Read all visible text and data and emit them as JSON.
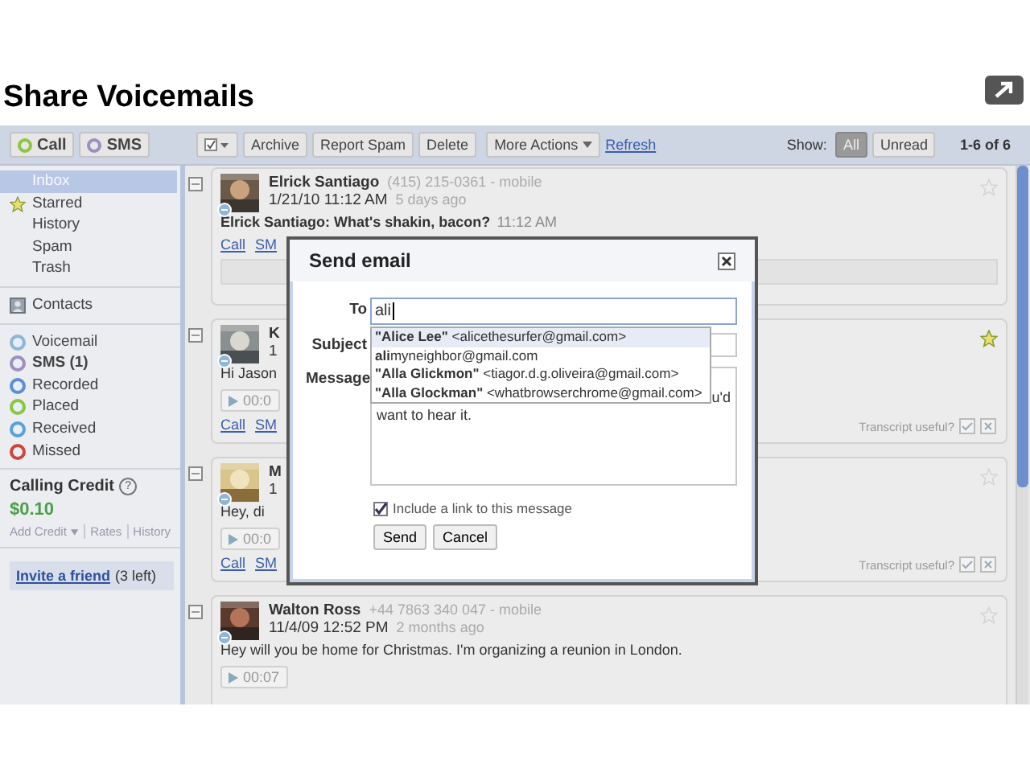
{
  "page": {
    "title": "Share Voicemails"
  },
  "toolbar": {
    "quick_buttons": [
      {
        "label": "Call",
        "color": "#8cc63e"
      },
      {
        "label": "SMS",
        "color": "#9c8fc0"
      }
    ],
    "actions": [
      "Archive",
      "Report Spam",
      "Delete"
    ],
    "more_actions": "More Actions",
    "refresh": "Refresh",
    "show_label": "Show:",
    "filters": [
      {
        "label": "All",
        "selected": true
      },
      {
        "label": "Unread",
        "selected": false
      }
    ],
    "pagination": "1-6 of 6"
  },
  "sidebar": {
    "folders": [
      {
        "label": "Inbox",
        "selected": true,
        "kind": "plain"
      },
      {
        "label": "Starred",
        "selected": false,
        "kind": "star"
      },
      {
        "label": "History",
        "selected": false,
        "kind": "plain"
      },
      {
        "label": "Spam",
        "selected": false,
        "kind": "plain"
      },
      {
        "label": "Trash",
        "selected": false,
        "kind": "plain"
      }
    ],
    "contacts": "Contacts",
    "categories": [
      {
        "label": "Voicemail",
        "color": "#8fb5d9",
        "unread": false
      },
      {
        "label": "SMS (1)",
        "color": "#9c8fc0",
        "unread": true
      },
      {
        "label": "Recorded",
        "color": "#5b8ed6",
        "unread": false
      },
      {
        "label": "Placed",
        "color": "#8cc63e",
        "unread": false
      },
      {
        "label": "Received",
        "color": "#5aa0d8",
        "unread": false
      },
      {
        "label": "Missed",
        "color": "#d0443a",
        "unread": false
      }
    ],
    "credit": {
      "title": "Calling Credit",
      "help": "?",
      "amount": "$0.10",
      "links": [
        "Add Credit",
        "Rates",
        "History"
      ]
    },
    "invite": {
      "link": "Invite a friend",
      "note": "(3 left)"
    }
  },
  "messages": [
    {
      "kind": "sms",
      "name": "Elrick Santiago",
      "phone": "(415) 215-0361 - mobile",
      "date": "1/21/10 11:12 AM",
      "ago": "5 days ago",
      "snippet": "Elrick Santiago: What's shakin, bacon?",
      "snippet_time": "11:12 AM",
      "actions": [
        "Call",
        "SM"
      ],
      "starred": false,
      "checked": false
    },
    {
      "kind": "voicemail",
      "name": "K",
      "date": "1",
      "snippet": "Hi Jason",
      "duration": "00:0",
      "actions": [
        "Call",
        "SM"
      ],
      "transcript_prompt": "Transcript useful?",
      "starred": true,
      "checked": false
    },
    {
      "kind": "voicemail",
      "name": "M",
      "date": "1",
      "snippet": "Hey, di",
      "duration": "00:0",
      "actions": [
        "Call",
        "SM"
      ],
      "transcript_prompt": "Transcript useful?",
      "starred": false,
      "checked": false
    },
    {
      "kind": "voicemail",
      "name": "Walton Ross",
      "phone": "+44 7863 340 047 - mobile",
      "date": "11/4/09 12:52 PM",
      "ago": "2 months ago",
      "snippet": "Hey will you be home for Christmas. I'm organizing a reunion in London.",
      "duration": "00:07",
      "starred": false,
      "checked": false
    }
  ],
  "dialog": {
    "title": "Send email",
    "to_label": "To",
    "to_value": "ali",
    "subject_label": "Subject",
    "message_label": "Message",
    "suggestions": [
      {
        "text": "**\"Alice Lee\"** <alicethesurfer@gmail.com>",
        "selected": true
      },
      {
        "text": "**ali**myneighbor@gmail.com",
        "selected": false
      },
      {
        "text": "**\"Alla Glickmon\"** <tiagor.d.g.oliveira@gmail.com>",
        "selected": false
      },
      {
        "text": "**\"Alla Glockman\"** <whatbrowserchrome@gmail.com>",
        "selected": false
      }
    ],
    "message_peek": "u'd",
    "message_tail": "want to hear it.",
    "include_link": {
      "label": "Include a link to this message",
      "checked": true
    },
    "buttons": [
      "Send",
      "Cancel"
    ]
  }
}
